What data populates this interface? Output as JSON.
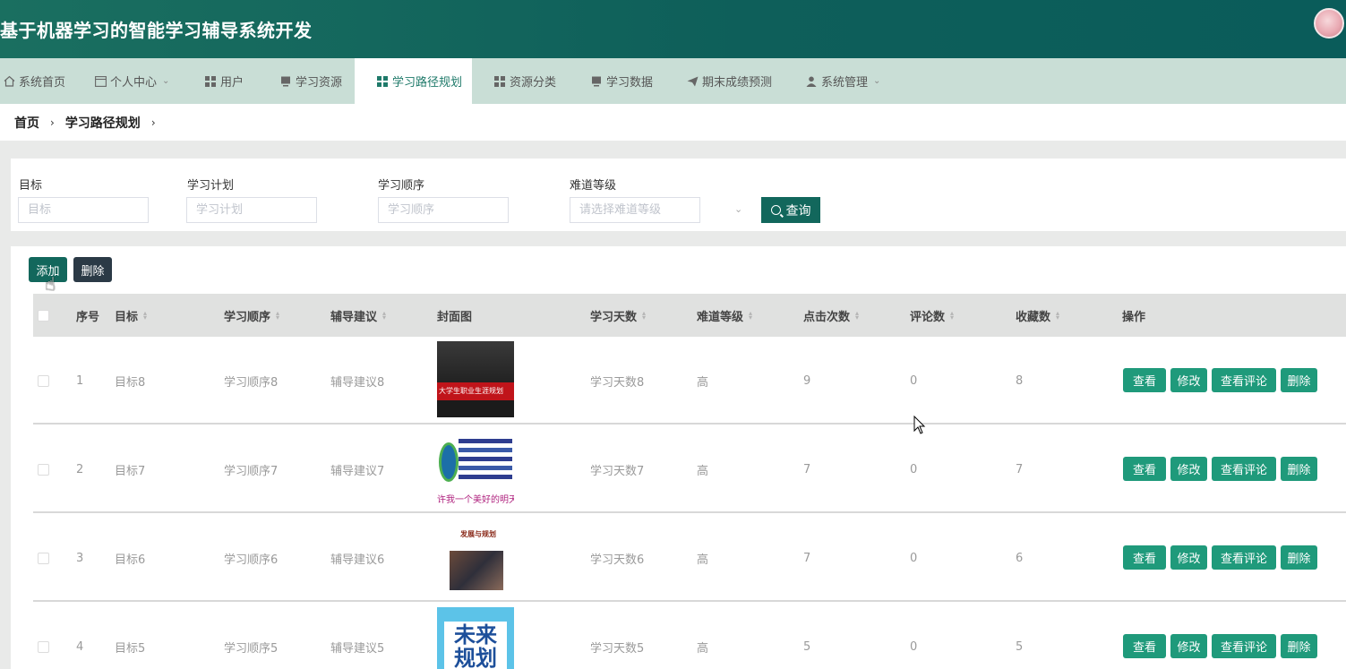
{
  "app": {
    "title": "基于机器学习的智能学习辅导系统开发"
  },
  "nav": [
    {
      "label": "系统首页",
      "icon": "home-icon"
    },
    {
      "label": "个人中心",
      "icon": "profile-card-icon",
      "dropdown": true
    },
    {
      "label": "用户",
      "icon": "grid-icon"
    },
    {
      "label": "学习资源",
      "icon": "monitor-icon"
    },
    {
      "label": "学习路径规划",
      "icon": "grid-icon",
      "active": true
    },
    {
      "label": "资源分类",
      "icon": "grid-icon"
    },
    {
      "label": "学习数据",
      "icon": "monitor-icon"
    },
    {
      "label": "期末成绩预测",
      "icon": "send-icon"
    },
    {
      "label": "系统管理",
      "icon": "user-icon",
      "dropdown": true
    }
  ],
  "breadcrumb": {
    "home": "首页",
    "current": "学习路径规划"
  },
  "search": {
    "target_label": "目标",
    "target_placeholder": "目标",
    "plan_label": "学习计划",
    "plan_placeholder": "学习计划",
    "order_label": "学习顺序",
    "order_placeholder": "学习顺序",
    "level_label": "难道等级",
    "level_placeholder": "请选择难道等级",
    "query_label": "查询"
  },
  "toolbar": {
    "add_label": "添加",
    "delete_label": "删除"
  },
  "table": {
    "headers": {
      "index": "序号",
      "target": "目标",
      "order": "学习顺序",
      "advice": "辅导建议",
      "cover": "封面图",
      "days": "学习天数",
      "level": "难道等级",
      "clicks": "点击次数",
      "comments": "评论数",
      "favorites": "收藏数",
      "actions": "操作"
    },
    "rows": [
      {
        "index": "1",
        "target": "目标8",
        "order": "学习顺序8",
        "advice": "辅导建议8",
        "days": "学习天数8",
        "level": "高",
        "clicks": "9",
        "comments": "0",
        "favorites": "8",
        "cover_text": "大学生职业生涯规划"
      },
      {
        "index": "2",
        "target": "目标7",
        "order": "学习顺序7",
        "advice": "辅导建议7",
        "days": "学习天数7",
        "level": "高",
        "clicks": "7",
        "comments": "0",
        "favorites": "7",
        "cover_text": "许我一个美好的明天"
      },
      {
        "index": "3",
        "target": "目标6",
        "order": "学习顺序6",
        "advice": "辅导建议6",
        "days": "学习天数6",
        "level": "高",
        "clicks": "7",
        "comments": "0",
        "favorites": "6",
        "cover_text": "发展与规划"
      },
      {
        "index": "4",
        "target": "目标5",
        "order": "学习顺序5",
        "advice": "辅导建议5",
        "days": "学习天数5",
        "level": "高",
        "clicks": "5",
        "comments": "0",
        "favorites": "5",
        "cover_text": "未来规划"
      }
    ],
    "actions": {
      "view": "查看",
      "edit": "修改",
      "view_comments": "查看评论",
      "delete": "删除"
    }
  },
  "colors": {
    "header": "#0e5f5a",
    "nav_bg": "#c9ded6",
    "primary_btn": "#12675c",
    "action_btn": "#1f9a7b",
    "dark_btn": "#2b3a46"
  }
}
